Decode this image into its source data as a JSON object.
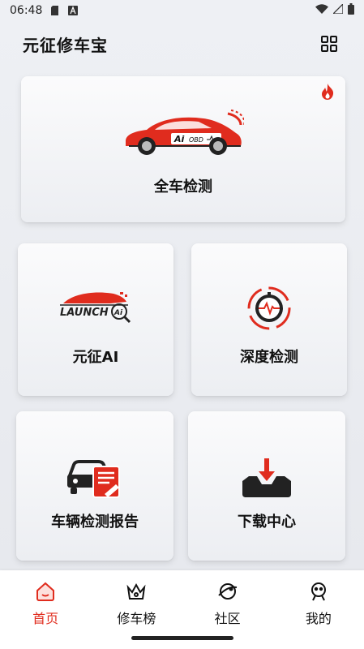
{
  "status_bar": {
    "time": "06:48",
    "icons": [
      "sd-card-icon",
      "a-notification-icon",
      "wifi-icon",
      "signal-icon",
      "battery-icon"
    ]
  },
  "header": {
    "title": "元征修车宝",
    "menu_icon": "grid-icon"
  },
  "cards": {
    "full_check": {
      "label": "全车检测",
      "icon": "car-obd-icon",
      "badge_icon": "fire-icon"
    },
    "ai": {
      "label": "元征AI",
      "icon": "launch-ai-icon"
    },
    "deep_check": {
      "label": "深度检测",
      "icon": "deep-diagnosis-icon"
    },
    "report": {
      "label": "车辆检测报告",
      "icon": "vehicle-report-icon"
    },
    "download": {
      "label": "下载中心",
      "icon": "download-tray-icon"
    }
  },
  "car_badge": {
    "ai": "Ai",
    "obd": "OBD"
  },
  "launch_logo": {
    "text": "LAUNCH",
    "ai": "Ai"
  },
  "tabs": [
    {
      "label": "首页",
      "icon": "home-icon",
      "active": true
    },
    {
      "label": "修车榜",
      "icon": "crown-icon",
      "active": false
    },
    {
      "label": "社区",
      "icon": "planet-icon",
      "active": false
    },
    {
      "label": "我的",
      "icon": "user-icon",
      "active": false
    }
  ],
  "colors": {
    "accent": "#e02c1e",
    "dark": "#1a1a1a"
  }
}
